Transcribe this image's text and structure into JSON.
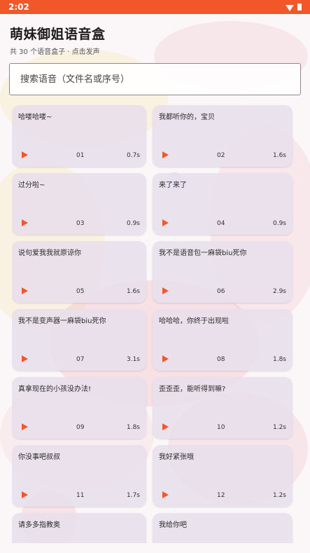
{
  "status_bar": {
    "time": "2:02",
    "icons": [
      "wifi-icon",
      "battery-icon"
    ]
  },
  "app": {
    "title": "萌妹御姐语音盒",
    "subtitle": "共 30 个语音盒子 · 点击发声"
  },
  "search": {
    "placeholder": "搜索语音（文件名或序号）",
    "value": ""
  },
  "colors": {
    "accent": "#f2572a",
    "card": "#e8e0ec"
  },
  "clips": [
    {
      "title": "哈喽哈喽~",
      "number": "01",
      "duration": "0.7s"
    },
    {
      "title": "我都听你的，宝贝",
      "number": "02",
      "duration": "1.6s"
    },
    {
      "title": "过分啦~",
      "number": "03",
      "duration": "0.9s"
    },
    {
      "title": "来了来了",
      "number": "04",
      "duration": "0.9s"
    },
    {
      "title": "说句爱我我就原谅你",
      "number": "05",
      "duration": "1.6s"
    },
    {
      "title": "我不是语音包一麻袋biu死你",
      "number": "06",
      "duration": "2.9s"
    },
    {
      "title": "我不是变声器一麻袋biu死你",
      "number": "07",
      "duration": "3.1s"
    },
    {
      "title": "哈哈哈，你终于出现啦",
      "number": "08",
      "duration": "1.8s"
    },
    {
      "title": "真拿现在的小孩没办法!",
      "number": "09",
      "duration": "1.8s"
    },
    {
      "title": "歪歪歪，能听得到嘛?",
      "number": "10",
      "duration": "1.2s"
    },
    {
      "title": "你没事吧叔叔",
      "number": "11",
      "duration": "1.7s"
    },
    {
      "title": "我好紧张哦",
      "number": "12",
      "duration": "1.2s"
    },
    {
      "title": "请多多指教奥",
      "number": "",
      "duration": ""
    },
    {
      "title": "我给你吧",
      "number": "",
      "duration": ""
    }
  ]
}
